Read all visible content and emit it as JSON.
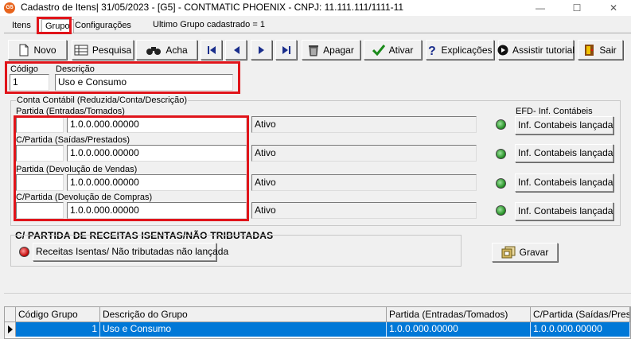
{
  "window": {
    "icon_text": "G5",
    "title": "Cadastro de Itens| 31/05/2023 - [G5] - CONTMATIC PHOENIX - CNPJ: 11.111.111/1111-11",
    "minimize": "—",
    "maximize": "☐",
    "close": "✕"
  },
  "tabs": [
    {
      "label": "Itens"
    },
    {
      "label": "Grupo"
    },
    {
      "label": "Configurações"
    }
  ],
  "status_last_group": "Ultimo Grupo cadastrado = 1",
  "toolbar": {
    "novo": "Novo",
    "pesquisa": "Pesquisa",
    "acha": "Acha",
    "apagar": "Apagar",
    "ativar": "Ativar",
    "explicacoes": "Explicações",
    "tutorial": "Assistir tutorial",
    "sair": "Sair"
  },
  "form": {
    "codigo_label": "Código",
    "codigo_value": "1",
    "descricao_label": "Descrição",
    "descricao_value": "Uso e Consumo"
  },
  "conta_contabil": {
    "group_label": "Conta Contábil (Reduzida/Conta/Descrição)",
    "efd_label": "EFD- Inf. Contábeis",
    "rows": [
      {
        "label": "Partida (Entradas/Tomados)",
        "reduzida": "",
        "conta": "1.0.0.000.00000",
        "descricao": "Ativo",
        "efd": "Inf. Contabeis lançada"
      },
      {
        "label": "C/Partida (Saídas/Prestados)",
        "reduzida": "",
        "conta": "1.0.0.000.00000",
        "descricao": "Ativo",
        "efd": "Inf. Contabeis lançada"
      },
      {
        "label": "Partida (Devolução de Vendas)",
        "reduzida": "",
        "conta": "1.0.0.000.00000",
        "descricao": "Ativo",
        "efd": "Inf. Contabeis lançada"
      },
      {
        "label": "C/Partida (Devolução de Compras)",
        "reduzida": "",
        "conta": "1.0.0.000.00000",
        "descricao": "Ativo",
        "efd": "Inf. Contabeis lançada"
      }
    ]
  },
  "receitas": {
    "heading": "C/ PARTIDA DE RECEITAS ISENTAS/NÃO TRIBUTADAS",
    "button": "Receitas Isentas/ Não tributadas não lançada"
  },
  "gravar": "Gravar",
  "grid": {
    "columns": [
      "Código Grupo",
      "Descrição do Grupo",
      "Partida (Entradas/Tomados)",
      "C/Partida (Saídas/Prestados)"
    ],
    "rows": [
      [
        "1",
        "Uso e Consumo",
        "1.0.0.000.00000",
        "1.0.0.000.00000"
      ]
    ]
  },
  "colors": {
    "highlight": "#e0141a",
    "selection": "#0078d7"
  }
}
